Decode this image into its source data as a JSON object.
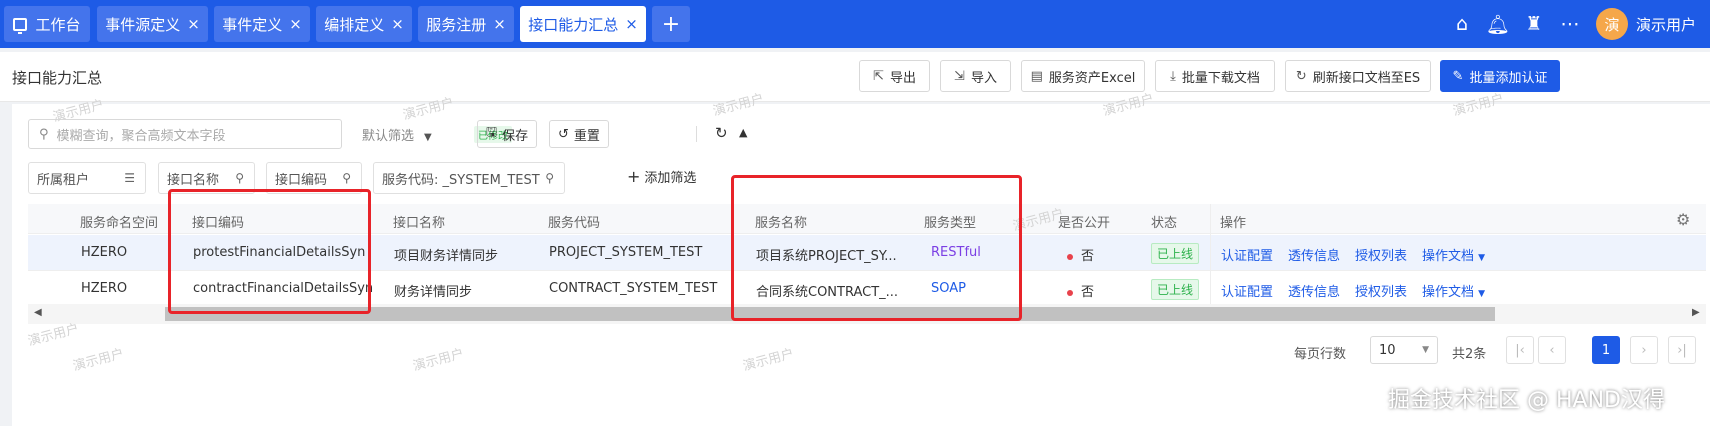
{
  "tabs": [
    {
      "label": "工作台",
      "closable": false,
      "active": false
    },
    {
      "label": "事件源定义",
      "closable": true,
      "active": false
    },
    {
      "label": "事件定义",
      "closable": true,
      "active": false
    },
    {
      "label": "编排定义",
      "closable": true,
      "active": false
    },
    {
      "label": "服务注册",
      "closable": true,
      "active": false
    },
    {
      "label": "接口能力汇总",
      "closable": true,
      "active": true
    }
  ],
  "add_tab_label": "+",
  "close_glyph": "×",
  "user": {
    "avatar_text": "演",
    "name": "演示用户"
  },
  "header_icons": [
    "home-icon",
    "bell-icon",
    "shirt-icon",
    "more-icon"
  ],
  "page": {
    "title": "接口能力汇总",
    "buttons": {
      "export": "导出",
      "import": "导入",
      "asset_excel": "服务资产Excel",
      "batch_download": "批量下载文档",
      "refresh_es": "刷新接口文档至ES",
      "batch_add_auth": "批量添加认证"
    }
  },
  "filter": {
    "search_placeholder": "模糊查询，聚合高频文本字段",
    "default_filter": "默认筛选",
    "modified_badge": "已修改",
    "save": "保存",
    "reset": "重置",
    "fields": {
      "tenant": "所属租户",
      "interface_name": "接口名称",
      "interface_code": "接口编码",
      "service_code": "服务代码: _SYSTEM_TEST"
    },
    "add_filter": "添加筛选"
  },
  "table": {
    "columns": {
      "namespace": "服务命名空间",
      "interface_code": "接口编码",
      "interface_name": "接口名称",
      "service_code": "服务代码",
      "service_name": "服务名称",
      "service_type": "服务类型",
      "public": "是否公开",
      "status": "状态",
      "actions": "操作"
    },
    "rows": [
      {
        "namespace": "HZERO",
        "interface_code": "protestFinancialDetailsSyn",
        "interface_name": "项目财务详情同步",
        "service_code": "PROJECT_SYSTEM_TEST",
        "service_name": "项目系统PROJECT_SY...",
        "service_type": "RESTful",
        "public": "否",
        "status": "已上线"
      },
      {
        "namespace": "HZERO",
        "interface_code": "contractFinancialDetailsSyn",
        "interface_name": "财务详情同步",
        "service_code": "CONTRACT_SYSTEM_TEST",
        "service_name": "合同系统CONTRACT_...",
        "service_type": "SOAP",
        "public": "否",
        "status": "已上线"
      }
    ],
    "row_actions": {
      "auth_config": "认证配置",
      "passthrough": "透传信息",
      "auth_list": "授权列表",
      "docs": "操作文档"
    }
  },
  "pagination": {
    "page_size_label": "每页行数",
    "page_size": "10",
    "total": "共2条",
    "current": "1"
  },
  "watermark": "演示用户",
  "footer_watermark": "掘金技术社区 @ HAND汉得",
  "colors": {
    "primary": "#1e5be6",
    "annotation_red": "#e82329",
    "online_green": "#2eb24d",
    "restful_purple": "#7b3fe4"
  }
}
